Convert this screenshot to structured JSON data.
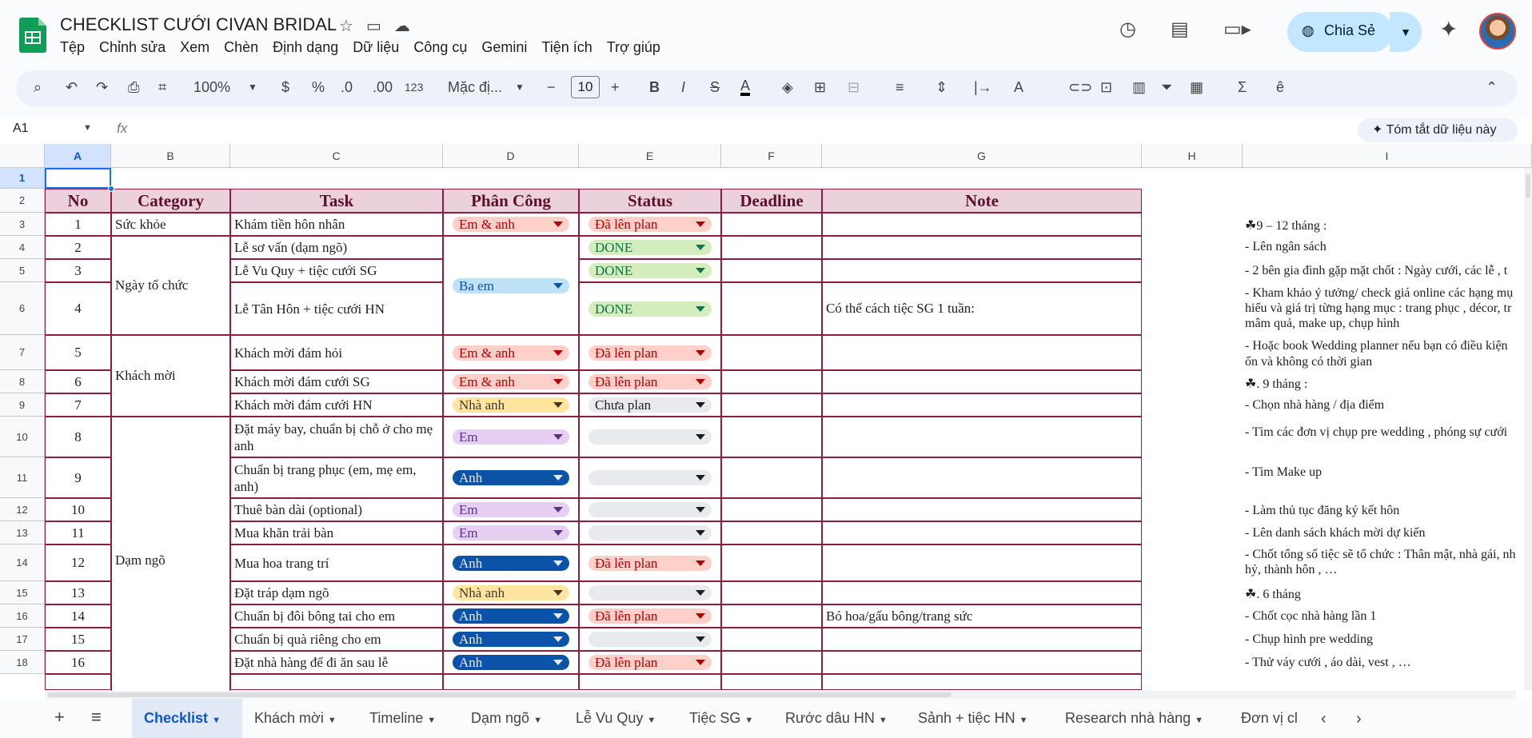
{
  "doc": {
    "title": "CHECKLIST CƯỚI CIVAN BRIDAL"
  },
  "menu": [
    "Tệp",
    "Chỉnh sửa",
    "Xem",
    "Chèn",
    "Định dạng",
    "Dữ liệu",
    "Công cụ",
    "Gemini",
    "Tiện ích",
    "Trợ giúp"
  ],
  "share_label": "Chia Sẻ",
  "toolbar": {
    "zoom": "100%",
    "currency": "$",
    "percent": "%",
    "dec_minus": ".0",
    "dec_plus": ".00",
    "num_fmt": "123",
    "font": "Mặc đị...",
    "font_size": "10"
  },
  "formula_bar": {
    "cell_ref": "A1",
    "fx": "fx",
    "summarize": "Tóm tắt dữ liệu này"
  },
  "columns": [
    "A",
    "B",
    "C",
    "D",
    "E",
    "F",
    "G",
    "H",
    "I"
  ],
  "rows": [
    "1",
    "2",
    "3",
    "4",
    "5",
    "6",
    "7",
    "8",
    "9",
    "10",
    "11",
    "12",
    "13",
    "14",
    "15",
    "16",
    "17",
    "18"
  ],
  "headers": {
    "no": "No",
    "category": "Category",
    "task": "Task",
    "assign": "Phân Công",
    "status": "Status",
    "deadline": "Deadline",
    "note": "Note"
  },
  "categories": {
    "health": "Sức khỏe",
    "date": "Ngày tổ chức",
    "guests": "Khách mời",
    "engage": "Dạm ngõ"
  },
  "tasks": [
    {
      "no": "1",
      "task": "Khám tiền hôn nhân",
      "assign": "Em & anh",
      "status": "Đã lên plan",
      "note": ""
    },
    {
      "no": "2",
      "task": "Lễ sơ vấn (dạm ngõ)",
      "assign": "",
      "status": "DONE",
      "note": ""
    },
    {
      "no": "3",
      "task": "Lễ Vu Quy + tiệc cưới SG",
      "assign": "",
      "status": "DONE",
      "note": ""
    },
    {
      "no": "4",
      "task": "Lễ Tân Hôn + tiệc cưới HN",
      "assign": "",
      "status": "DONE",
      "note": "Có thể cách tiệc SG 1 tuần:"
    },
    {
      "no": "5",
      "task": "Khách mời đám hỏi",
      "assign": "Em & anh",
      "status": "Đã lên plan",
      "note": ""
    },
    {
      "no": "6",
      "task": "Khách mời đám cưới SG",
      "assign": "Em & anh",
      "status": "Đã lên plan",
      "note": ""
    },
    {
      "no": "7",
      "task": "Khách mời đám cưới HN",
      "assign": "Nhà anh",
      "status": "Chưa plan",
      "note": ""
    },
    {
      "no": "8",
      "task": "Đặt máy bay, chuẩn bị chỗ ở cho mẹ anh",
      "assign": "Em",
      "status": "",
      "note": ""
    },
    {
      "no": "9",
      "task": "Chuẩn bị trang phục (em, mẹ em, anh)",
      "assign": "Anh",
      "status": "",
      "note": ""
    },
    {
      "no": "10",
      "task": "Thuê bàn dài (optional)",
      "assign": "Em",
      "status": "",
      "note": ""
    },
    {
      "no": "11",
      "task": "Mua khăn trải bàn",
      "assign": "Em",
      "status": "",
      "note": ""
    },
    {
      "no": "12",
      "task": "Mua hoa trang trí",
      "assign": "Anh",
      "status": "Đã lên plan",
      "note": ""
    },
    {
      "no": "13",
      "task": "Đặt tráp dạm ngõ",
      "assign": "Nhà anh",
      "status": "",
      "note": ""
    },
    {
      "no": "14",
      "task": "Chuẩn bị đôi bông tai cho em",
      "assign": "Anh",
      "status": "Đã lên plan",
      "note": "Bó hoa/gấu bông/trang sức"
    },
    {
      "no": "15",
      "task": "Chuẩn bị quà riêng cho em",
      "assign": "Anh",
      "status": "",
      "note": ""
    },
    {
      "no": "16",
      "task": "Đặt nhà hàng để đi ăn sau lễ",
      "assign": "Anh",
      "status": "Đã lên plan",
      "note": ""
    }
  ],
  "assign_shared": "Ba em",
  "col_i": [
    "☘9 – 12 tháng :",
    "- Lên ngân sách",
    "- 2 bên gia đình gặp mặt chốt  : Ngày cưới, các lễ , t",
    "- Kham khảo ý tưởng/ check giá online các hạng mụ",
    "hiểu và giá trị từng hạng mục : trang phục , décor, tr",
    "mâm quả, make up, chụp hình",
    "- Hoặc book Wedding planner nếu bạn có điều kiện",
    "ổn và không có thời gian",
    "☘. 9 tháng :",
    "- Chọn nhà hàng / địa điểm",
    "- Tìm các đơn vị chụp pre wedding , phóng sự cưới",
    "- Tìm Make up",
    "- Làm thủ tục đăng ký kết hôn",
    "- Lên danh sách khách mời dự kiến",
    "- Chốt tổng số tiệc sẽ tổ chức : Thân mật, nhà gái, nh",
    "hỷ, thành hôn , …",
    "☘. 6 tháng",
    "- Chốt cọc nhà hàng lần 1",
    "- Chụp hình pre wedding",
    "- Thử váy cưới , áo dài, vest , …"
  ],
  "sheet_tabs": [
    "Checklist",
    "Khách mời",
    "Timeline",
    "Dạm ngõ",
    "Lễ Vu Quy",
    "Tiệc SG",
    "Rước dâu HN",
    "Sảnh + tiệc HN",
    "Research nhà hàng",
    "Đơn vị cl"
  ],
  "colors": {
    "header_fill": "#ead1dc",
    "header_text": "#5b0f2a",
    "border": "#8e1c3c",
    "accent": "#1a73e8"
  }
}
